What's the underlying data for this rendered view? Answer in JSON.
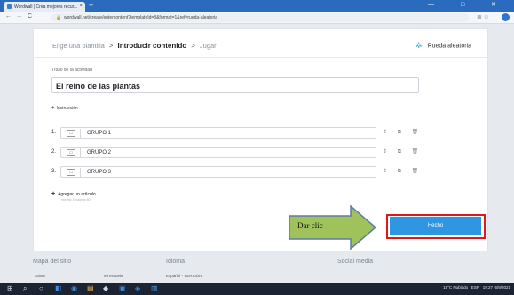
{
  "browser": {
    "tab_title": "Wordwall | Crea mejores recur...",
    "tab_close": "×",
    "new_tab": "+",
    "window_controls": "— □ ✕",
    "back": "←",
    "forward": "→",
    "reload": "C",
    "url": "wordwall.net/create/entercontent?templateId=8&format=1&ref=rueda-aleatoria",
    "addr_icons": "≣ ☆"
  },
  "breadcrumb": {
    "step1": "Elige una plantilla",
    "sep": ">",
    "step2": "Introducir contenido",
    "step3": "Jugar"
  },
  "template": {
    "label": "Rueda aleatoria",
    "icon": "pinwheel-icon"
  },
  "activity": {
    "title_label": "Título de la actividad",
    "title_value": "El reino de las plantas"
  },
  "instruction": {
    "plus": "+",
    "label": "Instrucción"
  },
  "items": [
    {
      "num": "1.",
      "text": "GRUPO 1"
    },
    {
      "num": "2.",
      "text": "GRUPO 2"
    },
    {
      "num": "3.",
      "text": "GRUPO 3"
    }
  ],
  "row_icons": "⇕ ⧉ 🗑",
  "add_item": {
    "plus": "+",
    "label": "Agregar un artículo",
    "sub": "mínimo 3 máximo 50"
  },
  "callout": {
    "text": "Dar clic",
    "colors": {
      "fill": "#9fc25a",
      "stroke": "#5b7da3"
    }
  },
  "done_button": {
    "label": "Hecho",
    "color": "#2f96e3",
    "frame_color": "#e2161b"
  },
  "footer": {
    "col1": "Mapa del sitio",
    "col1_sub1": "Sobre",
    "col1_sub2": "Mi escuela",
    "col2": "Idioma",
    "col2_sub": "Español - VERSIÓN",
    "col3": "Social media",
    "social": "f t"
  },
  "taskbar": {
    "start": "⊞",
    "search": "⌕",
    "icons": [
      "○",
      "◧",
      "◉",
      "▤",
      "◆",
      "▣",
      "◈",
      "▥"
    ],
    "weather": "18°C Nublado",
    "lang": "ESP",
    "time": "19:27",
    "date": "6/9/2021"
  }
}
